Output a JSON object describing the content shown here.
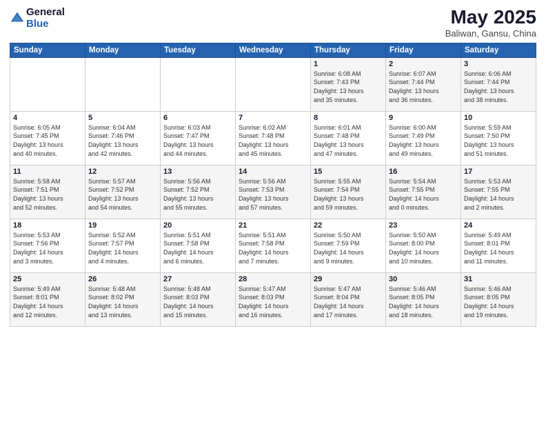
{
  "header": {
    "logo_general": "General",
    "logo_blue": "Blue",
    "month_title": "May 2025",
    "location": "Baliwan, Gansu, China"
  },
  "days_of_week": [
    "Sunday",
    "Monday",
    "Tuesday",
    "Wednesday",
    "Thursday",
    "Friday",
    "Saturday"
  ],
  "weeks": [
    [
      {
        "day": "",
        "info": ""
      },
      {
        "day": "",
        "info": ""
      },
      {
        "day": "",
        "info": ""
      },
      {
        "day": "",
        "info": ""
      },
      {
        "day": "1",
        "info": "Sunrise: 6:08 AM\nSunset: 7:43 PM\nDaylight: 13 hours\nand 35 minutes."
      },
      {
        "day": "2",
        "info": "Sunrise: 6:07 AM\nSunset: 7:44 PM\nDaylight: 13 hours\nand 36 minutes."
      },
      {
        "day": "3",
        "info": "Sunrise: 6:06 AM\nSunset: 7:44 PM\nDaylight: 13 hours\nand 38 minutes."
      }
    ],
    [
      {
        "day": "4",
        "info": "Sunrise: 6:05 AM\nSunset: 7:45 PM\nDaylight: 13 hours\nand 40 minutes."
      },
      {
        "day": "5",
        "info": "Sunrise: 6:04 AM\nSunset: 7:46 PM\nDaylight: 13 hours\nand 42 minutes."
      },
      {
        "day": "6",
        "info": "Sunrise: 6:03 AM\nSunset: 7:47 PM\nDaylight: 13 hours\nand 44 minutes."
      },
      {
        "day": "7",
        "info": "Sunrise: 6:02 AM\nSunset: 7:48 PM\nDaylight: 13 hours\nand 45 minutes."
      },
      {
        "day": "8",
        "info": "Sunrise: 6:01 AM\nSunset: 7:48 PM\nDaylight: 13 hours\nand 47 minutes."
      },
      {
        "day": "9",
        "info": "Sunrise: 6:00 AM\nSunset: 7:49 PM\nDaylight: 13 hours\nand 49 minutes."
      },
      {
        "day": "10",
        "info": "Sunrise: 5:59 AM\nSunset: 7:50 PM\nDaylight: 13 hours\nand 51 minutes."
      }
    ],
    [
      {
        "day": "11",
        "info": "Sunrise: 5:58 AM\nSunset: 7:51 PM\nDaylight: 13 hours\nand 52 minutes."
      },
      {
        "day": "12",
        "info": "Sunrise: 5:57 AM\nSunset: 7:52 PM\nDaylight: 13 hours\nand 54 minutes."
      },
      {
        "day": "13",
        "info": "Sunrise: 5:56 AM\nSunset: 7:52 PM\nDaylight: 13 hours\nand 55 minutes."
      },
      {
        "day": "14",
        "info": "Sunrise: 5:56 AM\nSunset: 7:53 PM\nDaylight: 13 hours\nand 57 minutes."
      },
      {
        "day": "15",
        "info": "Sunrise: 5:55 AM\nSunset: 7:54 PM\nDaylight: 13 hours\nand 59 minutes."
      },
      {
        "day": "16",
        "info": "Sunrise: 5:54 AM\nSunset: 7:55 PM\nDaylight: 14 hours\nand 0 minutes."
      },
      {
        "day": "17",
        "info": "Sunrise: 5:53 AM\nSunset: 7:55 PM\nDaylight: 14 hours\nand 2 minutes."
      }
    ],
    [
      {
        "day": "18",
        "info": "Sunrise: 5:53 AM\nSunset: 7:56 PM\nDaylight: 14 hours\nand 3 minutes."
      },
      {
        "day": "19",
        "info": "Sunrise: 5:52 AM\nSunset: 7:57 PM\nDaylight: 14 hours\nand 4 minutes."
      },
      {
        "day": "20",
        "info": "Sunrise: 5:51 AM\nSunset: 7:58 PM\nDaylight: 14 hours\nand 6 minutes."
      },
      {
        "day": "21",
        "info": "Sunrise: 5:51 AM\nSunset: 7:58 PM\nDaylight: 14 hours\nand 7 minutes."
      },
      {
        "day": "22",
        "info": "Sunrise: 5:50 AM\nSunset: 7:59 PM\nDaylight: 14 hours\nand 9 minutes."
      },
      {
        "day": "23",
        "info": "Sunrise: 5:50 AM\nSunset: 8:00 PM\nDaylight: 14 hours\nand 10 minutes."
      },
      {
        "day": "24",
        "info": "Sunrise: 5:49 AM\nSunset: 8:01 PM\nDaylight: 14 hours\nand 11 minutes."
      }
    ],
    [
      {
        "day": "25",
        "info": "Sunrise: 5:49 AM\nSunset: 8:01 PM\nDaylight: 14 hours\nand 12 minutes."
      },
      {
        "day": "26",
        "info": "Sunrise: 5:48 AM\nSunset: 8:02 PM\nDaylight: 14 hours\nand 13 minutes."
      },
      {
        "day": "27",
        "info": "Sunrise: 5:48 AM\nSunset: 8:03 PM\nDaylight: 14 hours\nand 15 minutes."
      },
      {
        "day": "28",
        "info": "Sunrise: 5:47 AM\nSunset: 8:03 PM\nDaylight: 14 hours\nand 16 minutes."
      },
      {
        "day": "29",
        "info": "Sunrise: 5:47 AM\nSunset: 8:04 PM\nDaylight: 14 hours\nand 17 minutes."
      },
      {
        "day": "30",
        "info": "Sunrise: 5:46 AM\nSunset: 8:05 PM\nDaylight: 14 hours\nand 18 minutes."
      },
      {
        "day": "31",
        "info": "Sunrise: 5:46 AM\nSunset: 8:05 PM\nDaylight: 14 hours\nand 19 minutes."
      }
    ]
  ]
}
